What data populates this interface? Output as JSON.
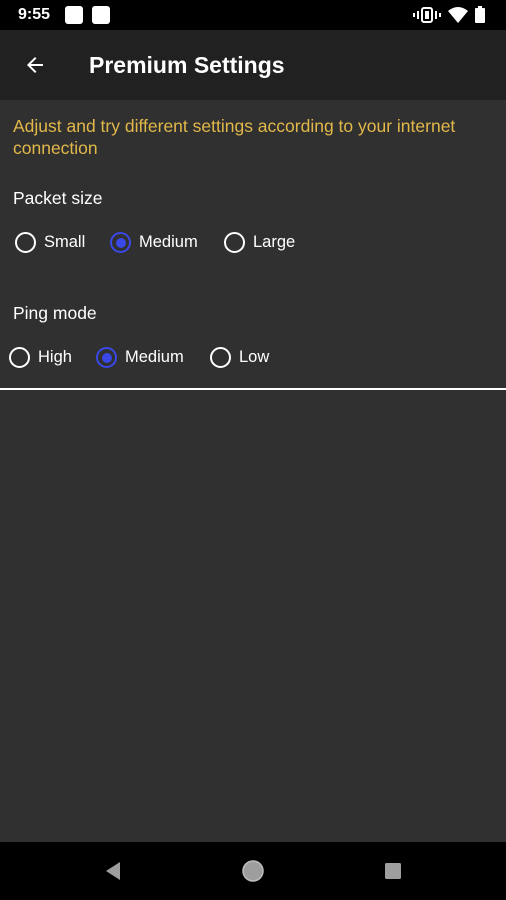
{
  "status_bar": {
    "time": "9:55",
    "icons": [
      "notification-square-icon",
      "notification-square-icon",
      "vibrate-icon",
      "wifi-icon",
      "battery-icon"
    ]
  },
  "app_bar": {
    "title": "Premium Settings",
    "back_icon": "arrow-left-icon"
  },
  "content": {
    "description": "Adjust and try different settings according to your internet connection",
    "packet_size": {
      "label": "Packet size",
      "options": [
        {
          "label": "Small",
          "checked": false
        },
        {
          "label": "Medium",
          "checked": true
        },
        {
          "label": "Large",
          "checked": false
        }
      ]
    },
    "ping_mode": {
      "label": "Ping mode",
      "options": [
        {
          "label": "High",
          "checked": false
        },
        {
          "label": "Medium",
          "checked": true
        },
        {
          "label": "Low",
          "checked": false
        }
      ]
    }
  },
  "nav_bar": {
    "icons": [
      "back-triangle-icon",
      "home-circle-icon",
      "recents-square-icon"
    ]
  },
  "colors": {
    "accent": "#3a48e8",
    "description_text": "#e2b84a",
    "app_bar": "#212121",
    "background": "#303030"
  }
}
